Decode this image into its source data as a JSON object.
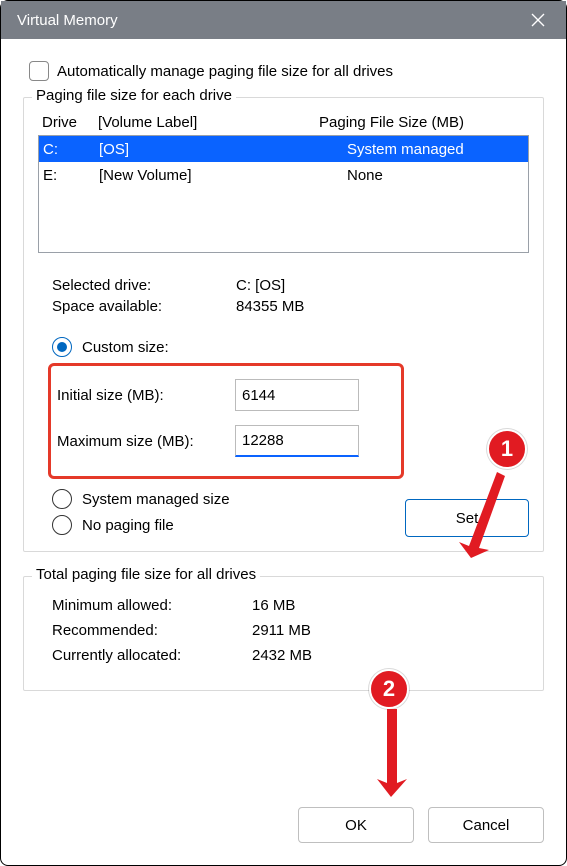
{
  "window": {
    "title": "Virtual Memory"
  },
  "autoManage": {
    "label": "Automatically manage paging file size for all drives"
  },
  "drivesGroup": {
    "legend": "Paging file size for each drive",
    "headers": {
      "drive": "Drive",
      "volume": "[Volume Label]",
      "paging": "Paging File Size (MB)"
    },
    "rows": [
      {
        "drive": "C:",
        "volume": "[OS]",
        "paging": "System managed",
        "selected": true
      },
      {
        "drive": "E:",
        "volume": "[New Volume]",
        "paging": "None",
        "selected": false
      }
    ]
  },
  "selected": {
    "driveLabel": "Selected drive:",
    "driveValue": "C:  [OS]",
    "spaceLabel": "Space available:",
    "spaceValue": "84355 MB"
  },
  "sizeOptions": {
    "custom": "Custom size:",
    "initialLabel": "Initial size (MB):",
    "initialValue": "6144",
    "maxLabel": "Maximum size (MB):",
    "maxValue": "12288",
    "systemManaged": "System managed size",
    "noPaging": "No paging file",
    "setButton": "Set"
  },
  "totals": {
    "legend": "Total paging file size for all drives",
    "minLabel": "Minimum allowed:",
    "minValue": "16 MB",
    "recLabel": "Recommended:",
    "recValue": "2911 MB",
    "curLabel": "Currently allocated:",
    "curValue": "2432 MB"
  },
  "buttons": {
    "ok": "OK",
    "cancel": "Cancel"
  },
  "annotations": {
    "step1": "1",
    "step2": "2"
  }
}
